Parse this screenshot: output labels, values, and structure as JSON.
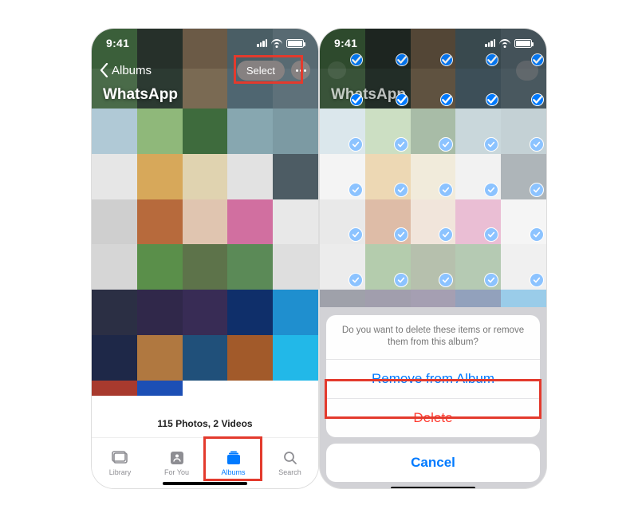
{
  "status": {
    "time": "9:41"
  },
  "nav": {
    "back_label": "Albums",
    "select_label": "Select"
  },
  "album": {
    "title": "WhatsApp",
    "summary": "115 Photos, 2 Videos",
    "add_glyph": "+"
  },
  "tabs": {
    "library": "Library",
    "for_you": "For You",
    "albums": "Albums",
    "search": "Search"
  },
  "action_sheet": {
    "message": "Do you want to delete these items or remove them from this album?",
    "remove": "Remove from Album",
    "delete": "Delete",
    "cancel": "Cancel"
  },
  "hero_colors_left": [
    "#3b5f3a",
    "#26302a",
    "#6b5a46",
    "#4a5e65",
    "#586a72",
    "#4a6b49",
    "#2c3a32",
    "#7a6a53",
    "#4f6671",
    "#5e717a"
  ],
  "hero_colors_right": [
    "#3b5f3a",
    "#26302a",
    "#6b5a46",
    "#4a5e65",
    "#586a72",
    "#4a6b49",
    "#2c3a32",
    "#7a6a53",
    "#4f6671",
    "#5e717a"
  ],
  "grid_left": [
    "#b0c9d6",
    "#8fb87a",
    "#3e6b3d",
    "#87a7b0",
    "#7c9aa3",
    "#e6e6e6",
    "#d7a85a",
    "#e0d3b0",
    "#e2e2e2",
    "#4d5c64",
    "#cfcfcf",
    "#b76a3c",
    "#e0c5b0",
    "#d16fa0",
    "#e8e8e8",
    "#d6d6d6",
    "#5a8f4a",
    "#5d734a",
    "#5b8a57",
    "#dedede",
    "#2b2f44",
    "#30284a",
    "#382c55",
    "#0f2f6a",
    "#1f8fcf",
    "#1e2848",
    "#b07840",
    "#20507a",
    "#a25a2a",
    "#22b8e8",
    "#a83a2e",
    "#1c4fb5",
    "#ffffff",
    "#ffffff",
    "#ffffff"
  ],
  "grid_right": [
    "#b0c9d6",
    "#8fb87a",
    "#3e6b3d",
    "#87a7b0",
    "#7c9aa3",
    "#e6e6e6",
    "#d7a85a",
    "#e0d3b0",
    "#e2e2e2",
    "#4d5c64",
    "#cfcfcf",
    "#b76a3c",
    "#e0c5b0",
    "#d16fa0",
    "#e8e8e8",
    "#d6d6d6",
    "#5a8f4a",
    "#5d734a",
    "#5b8a57",
    "#dedede",
    "#2b2f44",
    "#30284a",
    "#382c55",
    "#0f2f6a",
    "#1f8fcf"
  ]
}
